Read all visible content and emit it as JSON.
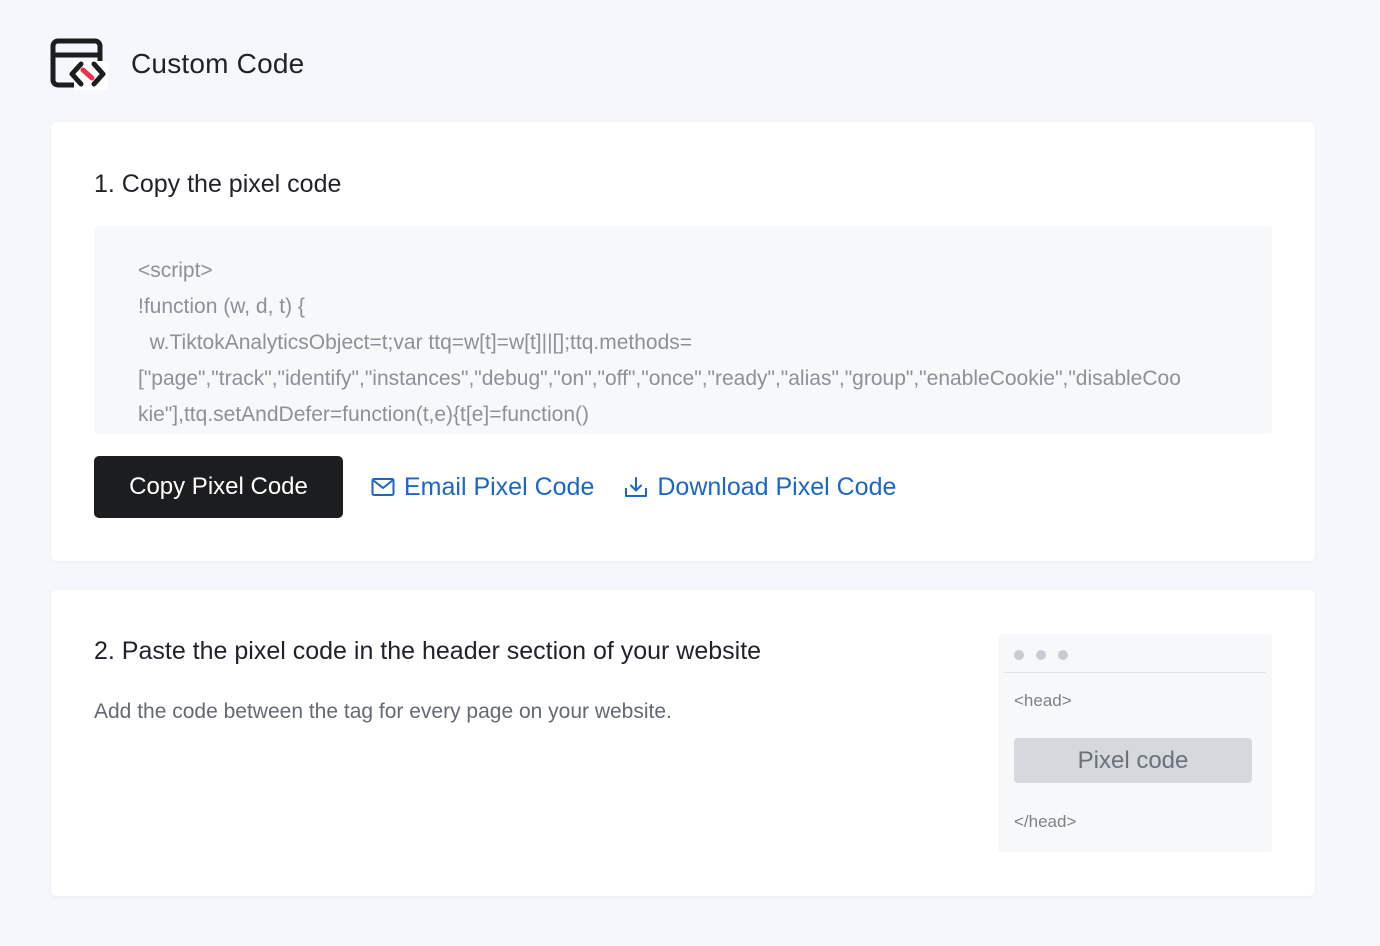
{
  "header": {
    "title": "Custom Code",
    "icon": "custom-code-icon"
  },
  "step1": {
    "title": "1. Copy the pixel code",
    "code_lines": [
      "<script>",
      "!function (w, d, t) {",
      "  w.TiktokAnalyticsObject=t;var ttq=w[t]=w[t]||[];ttq.methods=",
      "[\"page\",\"track\",\"identify\",\"instances\",\"debug\",\"on\",\"off\",\"once\",\"ready\",\"alias\",\"group\",\"enableCookie\",\"disableCoo",
      "kie\"],ttq.setAndDefer=function(t,e){t[e]=function()"
    ],
    "copy_button": "Copy Pixel Code",
    "email_link": "Email Pixel Code",
    "download_link": "Download Pixel Code"
  },
  "step2": {
    "title": "2. Paste the pixel code in the header section of your website",
    "description": "Add the code between the tag for every page on your website.",
    "preview": {
      "head_open": "<head>",
      "pixel_code": "Pixel code",
      "head_close": "</head>"
    }
  },
  "colors": {
    "background": "#f4f7fb",
    "card": "#ffffff",
    "primary_button": "#1c1d1f",
    "link": "#1a66c9",
    "logo_accent": "#e8334a"
  }
}
